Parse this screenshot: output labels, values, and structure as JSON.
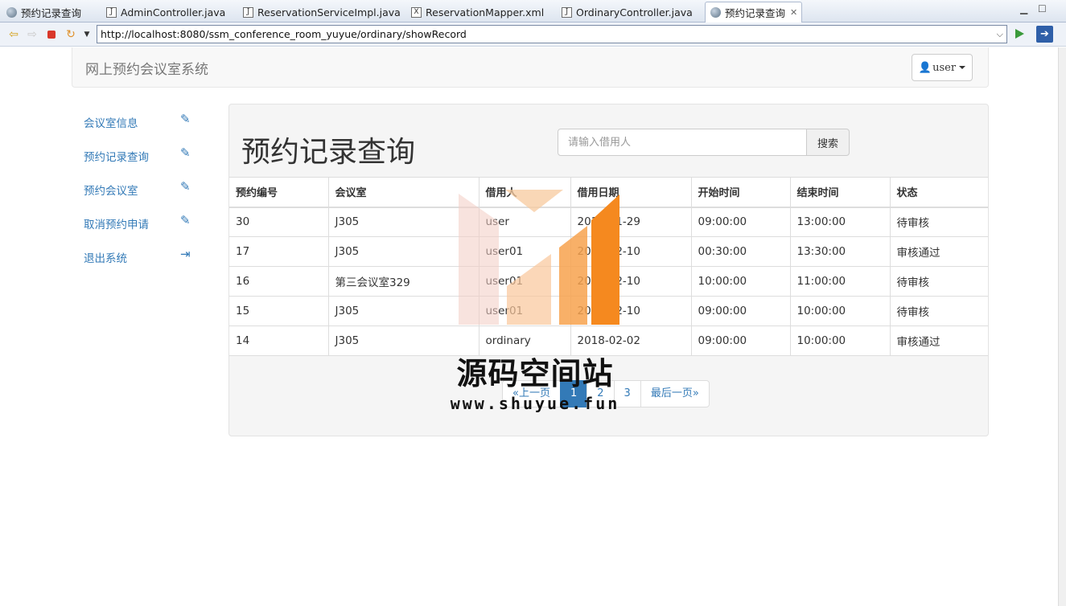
{
  "ide_tabs": [
    {
      "label": "预约记录查询",
      "icon": "globe-icon"
    },
    {
      "label": "AdminController.java",
      "icon": "java-file-icon"
    },
    {
      "label": "ReservationServiceImpl.java",
      "icon": "java-file-icon"
    },
    {
      "label": "ReservationMapper.xml",
      "icon": "xml-file-icon"
    },
    {
      "label": "OrdinaryController.java",
      "icon": "java-file-icon"
    },
    {
      "label": "预约记录查询",
      "icon": "globe-icon",
      "active": true
    }
  ],
  "browser": {
    "url": "http://localhost:8080/ssm_conference_room_yuyue/ordinary/showRecord"
  },
  "navbar": {
    "brand": "网上预约会议室系统",
    "user_label": "user"
  },
  "sidebar": {
    "items": [
      {
        "label": "会议室信息",
        "icon": "pencil-icon"
      },
      {
        "label": "预约记录查询",
        "icon": "pencil-icon"
      },
      {
        "label": "预约会议室",
        "icon": "pencil-icon"
      },
      {
        "label": "取消预约申请",
        "icon": "pencil-icon"
      },
      {
        "label": "退出系统",
        "icon": "logout-icon"
      }
    ]
  },
  "main": {
    "title": "预约记录查询",
    "search_placeholder": "请输入借用人",
    "search_button": "搜索",
    "table": {
      "headers": [
        "预约编号",
        "会议室",
        "借用人",
        "借用日期",
        "开始时间",
        "结束时间",
        "状态"
      ],
      "rows": [
        [
          "30",
          "J305",
          "user",
          "2018-01-29",
          "09:00:00",
          "13:00:00",
          "待审核"
        ],
        [
          "17",
          "J305",
          "user01",
          "2018-02-10",
          "00:30:00",
          "13:30:00",
          "审核通过"
        ],
        [
          "16",
          "第三会议室329",
          "user01",
          "2018-02-10",
          "10:00:00",
          "11:00:00",
          "待审核"
        ],
        [
          "15",
          "J305",
          "user01",
          "2018-02-10",
          "09:00:00",
          "10:00:00",
          "待审核"
        ],
        [
          "14",
          "J305",
          "ordinary",
          "2018-02-02",
          "09:00:00",
          "10:00:00",
          "审核通过"
        ]
      ]
    },
    "pagination": {
      "prev": "«上一页",
      "pages": [
        "1",
        "2",
        "3"
      ],
      "current": "1",
      "last": "最后一页»"
    }
  },
  "watermark": {
    "title": "源码空间站",
    "url": "www.shuyue.fun"
  },
  "colors": {
    "link": "#337ab7",
    "panel_bg": "#f5f5f5",
    "watermark_orange": "#f5891f"
  }
}
